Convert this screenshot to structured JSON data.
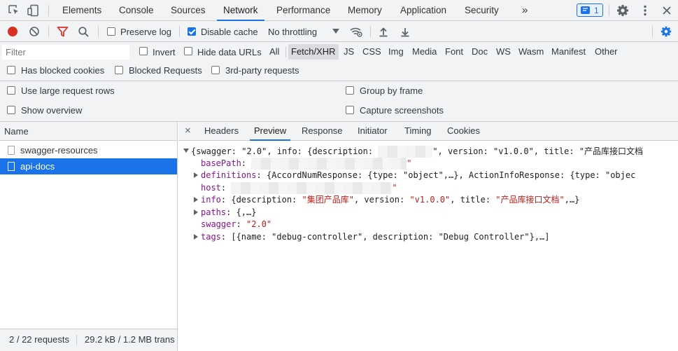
{
  "topbar": {
    "tabs": [
      "Elements",
      "Console",
      "Sources",
      "Network",
      "Performance",
      "Memory",
      "Application",
      "Security"
    ],
    "active_tab": "Network",
    "more_label": "»",
    "issues_count": "1"
  },
  "toolbar": {
    "preserve_log": "Preserve log",
    "disable_cache": "Disable cache",
    "throttling": "No throttling"
  },
  "filterbar": {
    "filter_placeholder": "Filter",
    "invert": "Invert",
    "hide_data_urls": "Hide data URLs",
    "types": [
      "All",
      "Fetch/XHR",
      "JS",
      "CSS",
      "Img",
      "Media",
      "Font",
      "Doc",
      "WS",
      "Wasm",
      "Manifest",
      "Other"
    ],
    "active_type": "Fetch/XHR",
    "has_blocked_cookies": "Has blocked cookies",
    "blocked_requests": "Blocked Requests",
    "third_party": "3rd-party requests"
  },
  "settings": {
    "large_rows": "Use large request rows",
    "show_overview": "Show overview",
    "group_by_frame": "Group by frame",
    "capture_screenshots": "Capture screenshots"
  },
  "requests": {
    "column_name": "Name",
    "items": [
      "swagger-resources",
      "api-docs"
    ],
    "selected": "api-docs",
    "status_count": "2 / 22 requests",
    "status_size": "29.2 kB / 1.2 MB trans"
  },
  "detail": {
    "close": "×",
    "tabs": [
      "Headers",
      "Preview",
      "Response",
      "Initiator",
      "Timing",
      "Cookies"
    ],
    "active_tab": "Preview"
  },
  "preview": {
    "root_prefix": "{swagger: \"2.0\", info: {description: ",
    "root_suffix": "\", version: \"v1.0.0\", title: \"产品库接口文档",
    "basepath_key": "basePath",
    "definitions_key": "definitions",
    "definitions_val": "{AccordNumResponse: {type: \"object\",…}, ActionInfoResponse: {type: \"objec",
    "host_key": "host",
    "info_key": "info",
    "info_val_1": "{description: ",
    "info_desc": "\"集团产品库\"",
    "info_val_2": ", version: ",
    "info_version": "\"v1.0.0\"",
    "info_val_3": ", title: ",
    "info_title": "\"产品库接口文档\"",
    "info_val_4": ",…}",
    "paths_key": "paths",
    "paths_val": "{,…}",
    "swagger_key": "swagger",
    "swagger_val": "\"2.0\"",
    "tags_key": "tags",
    "tags_val": "[{name: \"debug-controller\", description: \"Debug Controller\"},…]",
    "quote": "\""
  },
  "colors": {
    "accent": "#1a73e8",
    "record_red": "#d93025",
    "filter_red": "#d93025",
    "json_key": "#881391",
    "json_string": "#c41a16"
  }
}
